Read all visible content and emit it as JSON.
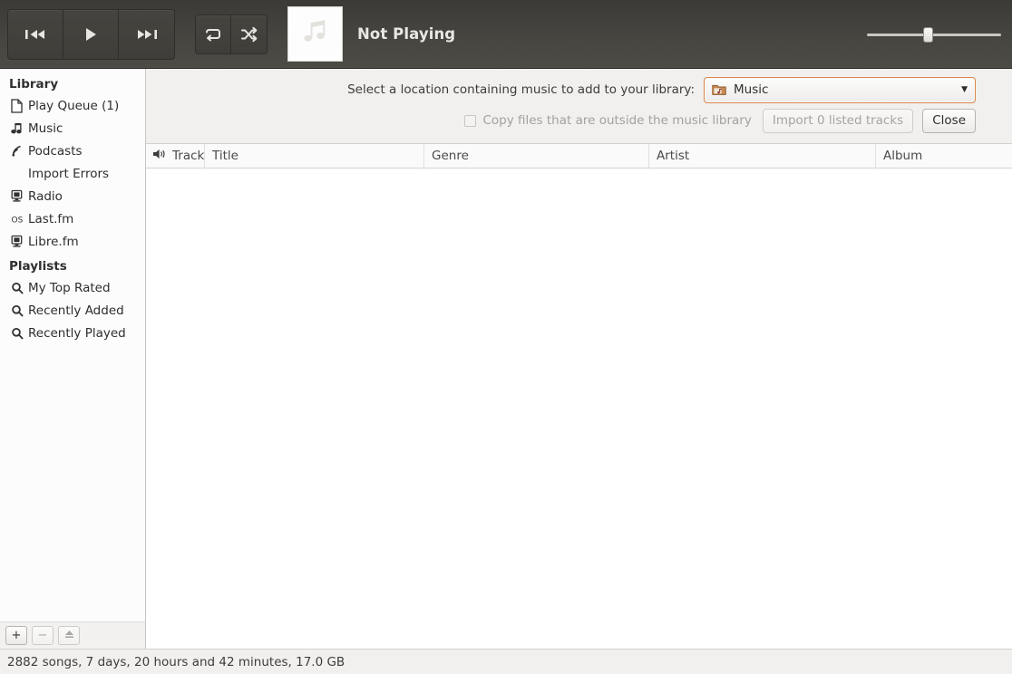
{
  "toolbar": {
    "prev_label": "previous",
    "play_label": "play",
    "next_label": "next",
    "repeat_label": "repeat",
    "shuffle_label": "shuffle",
    "now_playing": "Not Playing",
    "volume_percent": 42
  },
  "sidebar": {
    "sections": [
      {
        "title": "Library",
        "items": [
          {
            "label": "Play Queue (1)",
            "icon": "page-icon"
          },
          {
            "label": "Music",
            "icon": "music-note-icon"
          },
          {
            "label": "Podcasts",
            "icon": "rss-icon"
          },
          {
            "label": "Import Errors",
            "icon": "none"
          },
          {
            "label": "Radio",
            "icon": "monitor-icon"
          },
          {
            "label": "Last.fm",
            "icon": "lastfm-icon"
          },
          {
            "label": "Libre.fm",
            "icon": "monitor-icon"
          }
        ]
      },
      {
        "title": "Playlists",
        "items": [
          {
            "label": "My Top Rated",
            "icon": "magnifier-icon"
          },
          {
            "label": "Recently Added",
            "icon": "magnifier-icon"
          },
          {
            "label": "Recently Played",
            "icon": "magnifier-icon"
          }
        ]
      }
    ],
    "buttons": {
      "add": "+",
      "remove": "−",
      "eject": "eject"
    }
  },
  "import_bar": {
    "prompt": "Select a location containing music to add to your library:",
    "location_value": "Music",
    "copy_files_label": "Copy files that are outside the music library",
    "import_button": "Import 0 listed tracks",
    "close_button": "Close"
  },
  "tracklist": {
    "columns": [
      "Track",
      "Title",
      "Genre",
      "Artist",
      "Album"
    ],
    "rows": []
  },
  "statusbar": {
    "summary": "2882 songs, 7 days, 20 hours and 42 minutes, 17.0 GB"
  },
  "colors": {
    "toolbar_bg": "#474540",
    "accent_focus": "#d9864a",
    "panel_bg": "#f1f0ee",
    "sidebar_bg": "#fcfcfc"
  }
}
